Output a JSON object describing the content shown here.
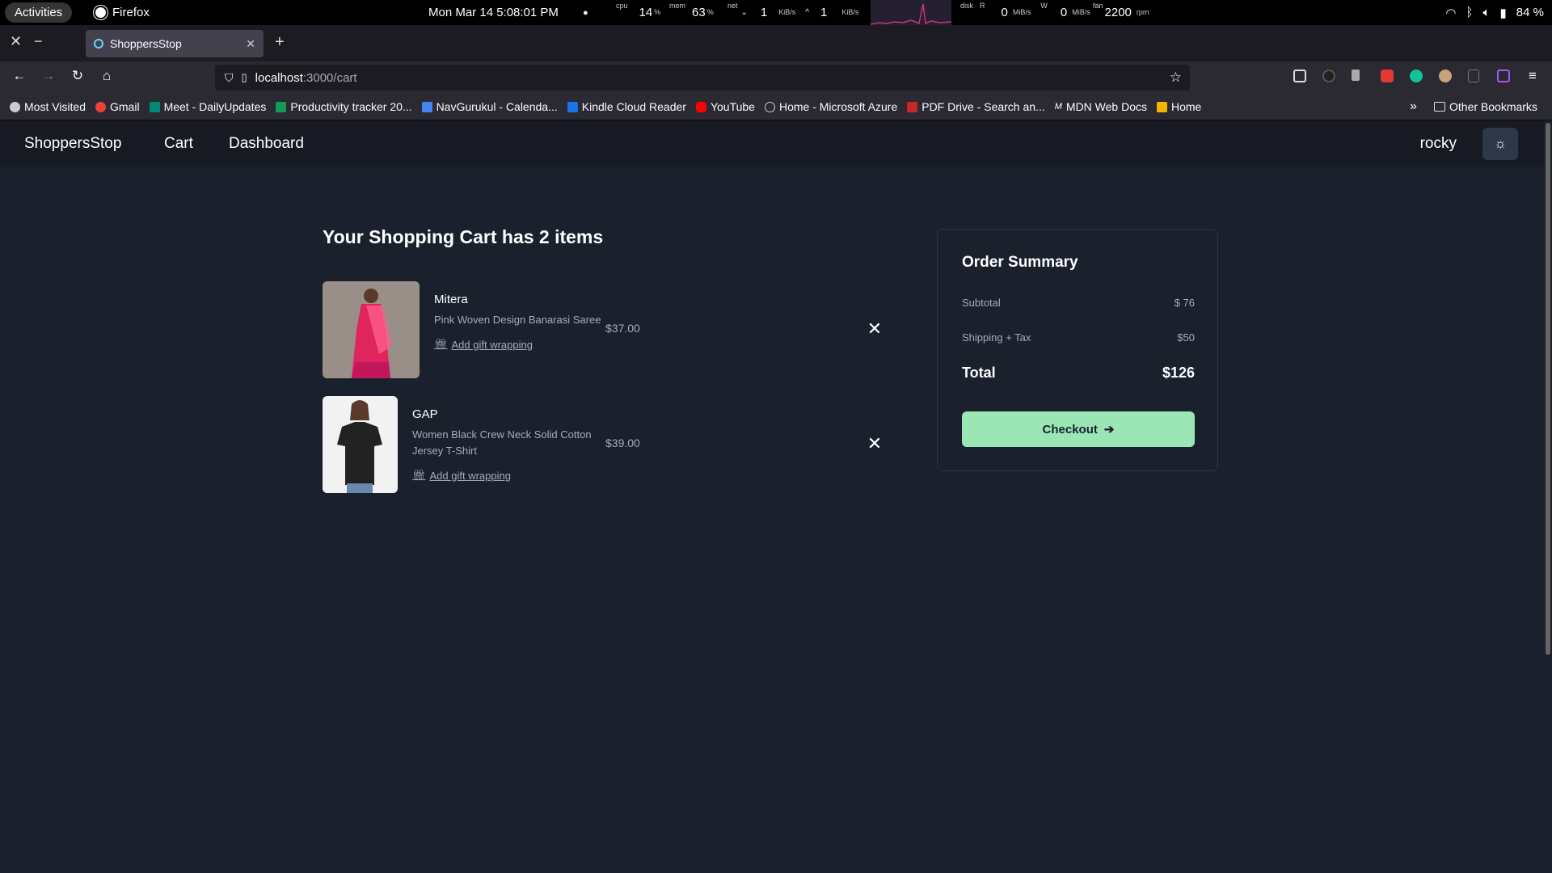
{
  "system_bar": {
    "activities": "Activities",
    "app_name": "Firefox",
    "datetime": "Mon Mar 14   5:08:01 PM",
    "cpu_label": "cpu",
    "cpu_value": "14",
    "cpu_unit": "%",
    "mem_label": "mem",
    "mem_value": "63",
    "mem_unit": "%",
    "net_label": "net",
    "net_down": "1",
    "net_up": "1",
    "net_unit": "KiB/s",
    "disk_label": "disk",
    "disk_r_label": "R",
    "disk_r": "0",
    "disk_w_label": "W",
    "disk_w": "0",
    "disk_unit": "MiB/s",
    "fan_label": "fan",
    "fan_value": "2200",
    "fan_unit": "rpm",
    "battery": "84 %"
  },
  "browser": {
    "tab_title": "ShoppersStop",
    "url_host": "localhost",
    "url_path": ":3000/cart",
    "bookmarks": [
      {
        "label": "Most Visited",
        "color": "#cccccc"
      },
      {
        "label": "Gmail",
        "color": "#ea4335"
      },
      {
        "label": "Meet - DailyUpdates",
        "color": "#00897b"
      },
      {
        "label": "Productivity tracker 20...",
        "color": "#0f9d58"
      },
      {
        "label": "NavGurukul - Calenda...",
        "color": "#4285f4"
      },
      {
        "label": "Kindle Cloud Reader",
        "color": "#1a73e8"
      },
      {
        "label": "YouTube",
        "color": "#ff0000"
      },
      {
        "label": "Home - Microsoft Azure",
        "color": "#cccccc"
      },
      {
        "label": "PDF Drive - Search an...",
        "color": "#c62828"
      },
      {
        "label": "MDN Web Docs",
        "color": "#ffffff"
      },
      {
        "label": "Home",
        "color": "#f4b400"
      }
    ],
    "other_bookmarks": "Other Bookmarks"
  },
  "app_nav": {
    "brand": "ShoppersStop",
    "links": [
      "Cart",
      "Dashboard"
    ],
    "user": "rocky"
  },
  "cart": {
    "title": "Your Shopping Cart has 2 items",
    "items": [
      {
        "brand": "Mitera",
        "description": "Pink Woven Design Banarasi Saree",
        "gift": "Add gift wrapping",
        "price": "$37.00"
      },
      {
        "brand": "GAP",
        "description": "Women Black Crew Neck Solid Cotton Jersey T-Shirt",
        "gift": "Add gift wrapping",
        "price": "$39.00"
      }
    ]
  },
  "summary": {
    "title": "Order Summary",
    "subtotal_label": "Subtotal",
    "subtotal_value": "$ 76",
    "shipping_label": "Shipping + Tax",
    "shipping_value": "$50",
    "total_label": "Total",
    "total_value": "$126",
    "checkout_label": "Checkout"
  },
  "colors": {
    "page_bg": "#1a202c",
    "nav_bg": "#171923",
    "checkout_bg": "#9ae6b4"
  }
}
